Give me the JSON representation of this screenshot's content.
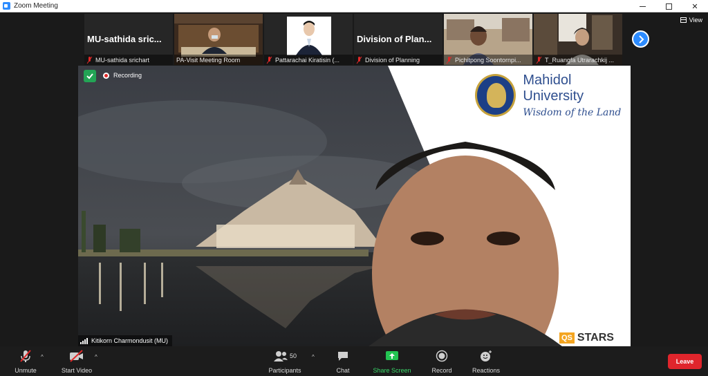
{
  "window": {
    "title": "Zoom Meeting"
  },
  "strip": {
    "tiles": [
      {
        "big_name": "MU-sathida sric...",
        "label": "MU-sathida srichart"
      },
      {
        "label": "PA-Visit Meeting Room"
      },
      {
        "label": "Pattarachai Kiratisin (..."
      },
      {
        "big_name": "Division of Plan...",
        "label": "Division of Planning"
      },
      {
        "label": "Pichitpong Soontornpi..."
      },
      {
        "label": "T_Ruangfa Utrarachkij ..."
      }
    ]
  },
  "view_label": "View",
  "speaker": {
    "recording_label": "Recording",
    "name": "Kitikorn Charmondusit (MU)",
    "brand_name": "Mahidol University",
    "brand_tagline": "Wisdom of the Land",
    "qs_label": "QS",
    "stars_label": "STARS"
  },
  "toolbar": {
    "unmute": "Unmute",
    "start_video": "Start Video",
    "participants": "Participants",
    "participant_count": "50",
    "chat": "Chat",
    "share_screen": "Share Screen",
    "record": "Record",
    "reactions": "Reactions",
    "leave": "Leave"
  },
  "colors": {
    "accent": "#2d8cff",
    "share_green": "#3bd86a",
    "leave_red": "#e0252c",
    "shield_green": "#23a455"
  }
}
